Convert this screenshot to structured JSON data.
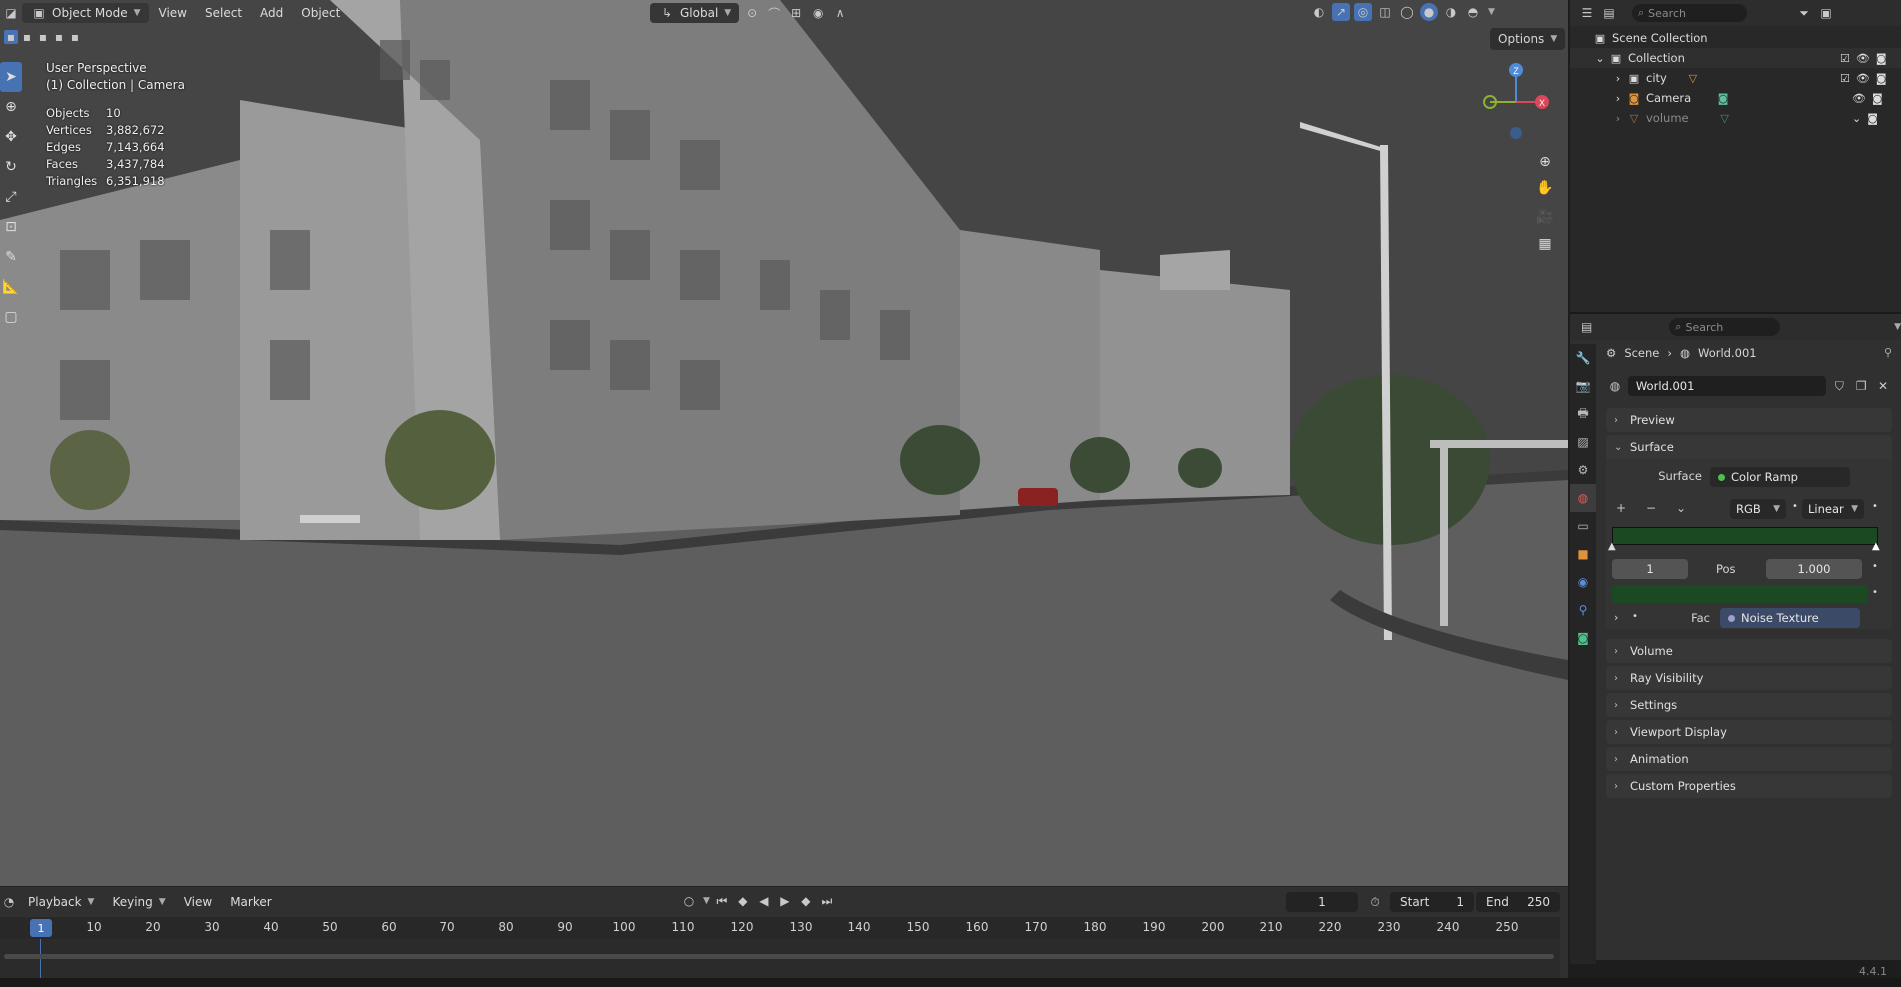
{
  "viewport_header": {
    "mode_label": "Object Mode",
    "menus": [
      "View",
      "Select",
      "Add",
      "Object"
    ],
    "orientation_label": "Global",
    "options_label": "Options"
  },
  "viewport_overlay": {
    "perspective": "User Perspective",
    "collection_info": "(1) Collection | Camera",
    "stats": [
      {
        "key": "Objects",
        "value": "10"
      },
      {
        "key": "Vertices",
        "value": "3,882,672"
      },
      {
        "key": "Edges",
        "value": "7,143,664"
      },
      {
        "key": "Faces",
        "value": "3,437,784"
      },
      {
        "key": "Triangles",
        "value": "6,351,918"
      }
    ]
  },
  "gizmo": {
    "z": "Z",
    "x": "X"
  },
  "timeline": {
    "menus": [
      "Playback",
      "Keying",
      "View",
      "Marker"
    ],
    "current_frame": "1",
    "start_label": "Start",
    "start_value": "1",
    "end_label": "End",
    "end_value": "250",
    "ticks": [
      "10",
      "20",
      "30",
      "40",
      "50",
      "60",
      "70",
      "80",
      "90",
      "100",
      "110",
      "120",
      "130",
      "140",
      "150",
      "160",
      "170",
      "180",
      "190",
      "200",
      "210",
      "220",
      "230",
      "240",
      "250"
    ],
    "playhead": "1"
  },
  "outliner": {
    "search_placeholder": "Search",
    "items": [
      {
        "label": "Scene Collection",
        "level": 0
      },
      {
        "label": "Collection",
        "level": 1
      },
      {
        "label": "city",
        "level": 2
      },
      {
        "label": "Camera",
        "level": 2
      },
      {
        "label": "volume",
        "level": 2
      }
    ]
  },
  "properties": {
    "search_placeholder": "Search",
    "breadcrumb_scene": "Scene",
    "breadcrumb_world": "World.001",
    "world_name": "World.001",
    "panels": {
      "preview": "Preview",
      "surface": "Surface",
      "volume": "Volume",
      "ray_visibility": "Ray Visibility",
      "settings": "Settings",
      "viewport_display": "Viewport Display",
      "animation": "Animation",
      "custom_properties": "Custom Properties"
    },
    "surface_label": "Surface",
    "surface_value": "Color Ramp",
    "color_mode": "RGB",
    "interpolation": "Linear",
    "stop_index": "1",
    "pos_label": "Pos",
    "pos_value": "1.000",
    "fac_label": "Fac",
    "fac_value": "Noise Texture"
  },
  "colors": {
    "accent": "#4772b3",
    "ramp_green": "#1b4a22",
    "world_tab": "#e05b5b"
  },
  "version": "4.4.1"
}
